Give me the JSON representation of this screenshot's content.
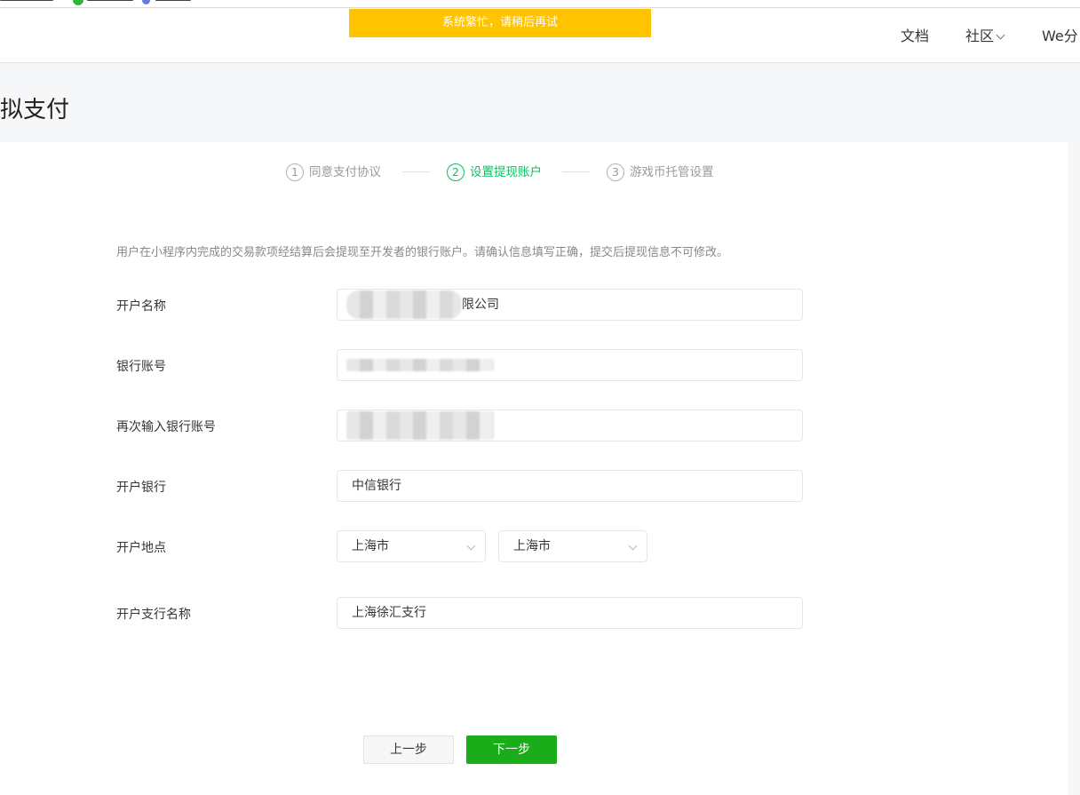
{
  "toast": {
    "text": "系统繁忙，请稍后再试"
  },
  "nav": {
    "docs": "文档",
    "community": "社区",
    "we": "We分"
  },
  "page": {
    "title": "拟支付"
  },
  "steps": [
    {
      "num": "1",
      "label": "同意支付协议",
      "state": "done"
    },
    {
      "num": "2",
      "label": "设置提现账户",
      "state": "active"
    },
    {
      "num": "3",
      "label": "游戏币托管设置",
      "state": "pending"
    }
  ],
  "notice": "用户在小程序内完成的交易款项经结算后会提现至开发者的银行账户。请确认信息填写正确，提交后提现信息不可修改。",
  "form": {
    "account_name": {
      "label": "开户名称",
      "value_suffix": "限公司"
    },
    "bank_account": {
      "label": "银行账号"
    },
    "bank_account_confirm": {
      "label": "再次输入银行账号"
    },
    "bank": {
      "label": "开户银行",
      "value": "中信银行"
    },
    "location": {
      "label": "开户地点",
      "province": "上海市",
      "city": "上海市"
    },
    "branch": {
      "label": "开户支行名称",
      "value": "上海徐汇支行"
    }
  },
  "buttons": {
    "prev": "上一步",
    "next": "下一步"
  },
  "colors": {
    "accent": "#07c160",
    "primary_button": "#1aad19",
    "toast": "#ffc300"
  }
}
